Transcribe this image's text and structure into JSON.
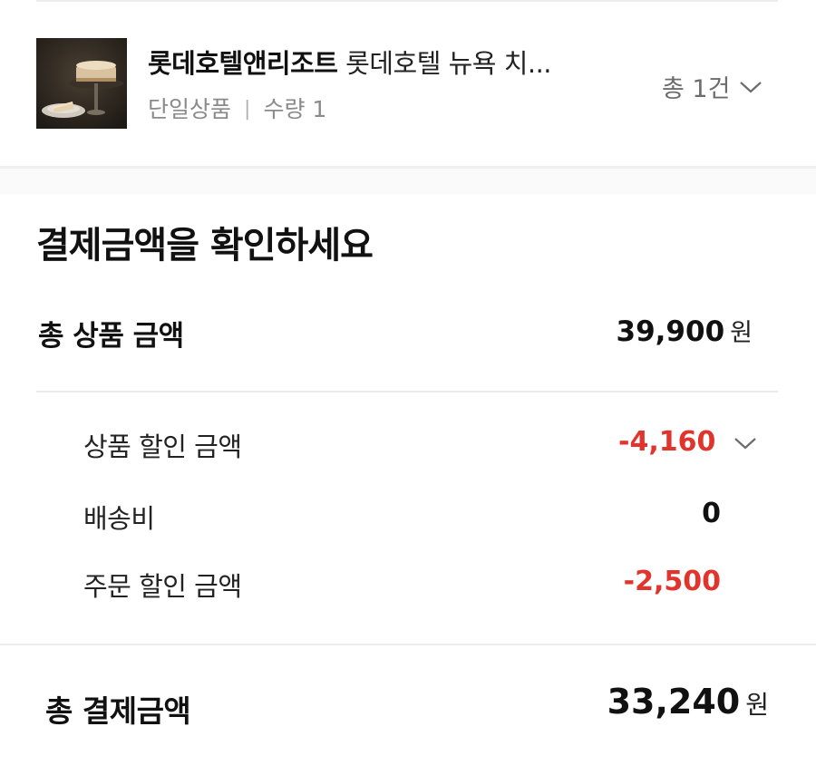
{
  "product": {
    "brand": "롯데호텔앤리조트",
    "name": "롯데호텔 뉴욕 치...",
    "option": "단일상품",
    "separator": "|",
    "quantity": "수량 1",
    "total_count": "총 1건"
  },
  "summary": {
    "title": "결제금액을 확인하세요",
    "total_product_label": "총 상품 금액",
    "total_product_value": "39,900",
    "currency": "원",
    "product_discount_label": "상품 할인 금액",
    "product_discount_value": "-4,160",
    "shipping_label": "배송비",
    "shipping_value": "0",
    "order_discount_label": "주문 할인 금액",
    "order_discount_value": "-2,500",
    "grand_total_label": "총 결제금액",
    "grand_total_value": "33,240"
  },
  "colors": {
    "discount": "#e0342c",
    "muted": "#8a8a8a",
    "divider": "#ececec"
  },
  "icons": [
    "chevron-down-icon"
  ]
}
